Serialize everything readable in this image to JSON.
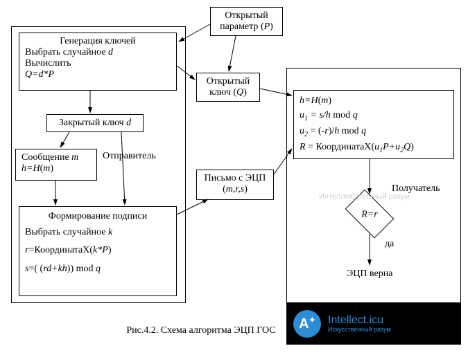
{
  "top_param": {
    "line1": "Открытый",
    "line2": "параметр (",
    "sym": "P",
    "close": ")"
  },
  "sender_outer": "Отправитель",
  "keygen": {
    "title": "Генерация ключей",
    "l1a": "Выбрать случайное ",
    "l1b": "d",
    "l2": "Вычислить",
    "l3a": "Q=d*P"
  },
  "priv_key": {
    "txt": "Закрытый ключ ",
    "sym": "d"
  },
  "msg": {
    "l1": "Сообщение ",
    "sym": "m",
    "l2a": "h=H",
    "l2b": "(",
    "l2c": "m",
    "l2d": ")"
  },
  "sign": {
    "title": "Формирование подписи",
    "l1a": "Выбрать случайное ",
    "l1b": "k",
    "l2a": "r",
    "l2b": "=КоординатаX(",
    "l2c": "k*P",
    "l2d": ")",
    "l3a": "s",
    "l3b": "=( (",
    "l3c": "rd+kh",
    "l3d": ")) mod ",
    "l3e": "q"
  },
  "pub_key": {
    "l1": "Открытый",
    "l2a": "ключ (",
    "l2b": "Q",
    "l2c": ")"
  },
  "letter": {
    "l1": "Письмо с ЭЦП",
    "l2a": "(",
    "l2b": "m,r,s",
    "l2c": ")"
  },
  "receiver": "Получатель",
  "verify": {
    "l1a": "h=H",
    "l1b": "(",
    "l1c": "m",
    "l1d": ")",
    "l2a": "u",
    "l2b": "1",
    "l2c": " = s/h",
    "l2d": " mod ",
    "l2e": "q",
    "l3a": "u",
    "l3b": "2",
    "l3c": " = (-",
    "l3d": "r",
    "l3e": ")/",
    "l3f": "h",
    "l3g": " mod ",
    "l3h": "q",
    "l4a": "R",
    "l4b": " = КоординатаX(",
    "l4c": "u",
    "l4d": "1",
    "l4e": "P+u",
    "l4f": "2",
    "l4g": "Q",
    "l4h": ")"
  },
  "decision": "R=r",
  "yes": "да",
  "valid": "ЭЦП верна",
  "caption": "Рис.4.2. Схема алгоритма ЭЦП ГОС",
  "watermark": "Интеллектуальный разум",
  "logo": {
    "icon": "A",
    "main": "Intellect.icu",
    "sub": "Искусственный разум"
  }
}
